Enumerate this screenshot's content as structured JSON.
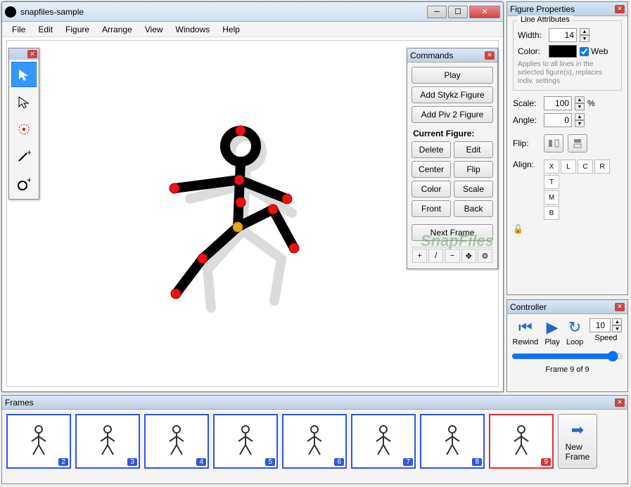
{
  "main": {
    "title": "snapfiles-sample",
    "menus": [
      "File",
      "Edit",
      "Figure",
      "Arrange",
      "View",
      "Windows",
      "Help"
    ]
  },
  "tools": {
    "items": [
      "select-filled",
      "select-hollow",
      "target",
      "line-add",
      "circle-add"
    ],
    "active_index": 0
  },
  "commands": {
    "title": "Commands",
    "play": "Play",
    "add_stykz": "Add Stykz Figure",
    "add_piv2": "Add Piv 2 Figure",
    "current_label": "Current Figure:",
    "delete": "Delete",
    "edit": "Edit",
    "center": "Center",
    "flip": "Flip",
    "color": "Color",
    "scale": "Scale",
    "front": "Front",
    "back": "Back",
    "next_frame": "Next Frame",
    "iconbar": [
      "+",
      "/",
      "−",
      "✥",
      "⚙"
    ]
  },
  "figprops": {
    "title": "Figure Properties",
    "line_legend": "Line Attributes",
    "width_label": "Width:",
    "width_value": "14",
    "color_label": "Color:",
    "color_value": "#000000",
    "web_label": "Web",
    "web_checked": true,
    "note": "Applies to all lines in the selected figure(s), replaces indiv. settings",
    "scale_label": "Scale:",
    "scale_value": "100",
    "scale_unit": "%",
    "angle_label": "Angle:",
    "angle_value": "0",
    "flip_label": "Flip:",
    "align_label": "Align:",
    "align_btns": [
      "X",
      "L",
      "C",
      "R",
      "T",
      "M",
      "B"
    ]
  },
  "controller": {
    "title": "Controller",
    "rewind": "Rewind",
    "play": "Play",
    "loop": "Loop",
    "speed": "Speed",
    "speed_value": "10",
    "status": "Frame 9 of 9"
  },
  "frames": {
    "title": "Frames",
    "items": [
      2,
      3,
      4,
      5,
      6,
      7,
      8,
      9
    ],
    "current": 9,
    "new_label": "New Frame"
  },
  "watermark": "SnapFiles"
}
